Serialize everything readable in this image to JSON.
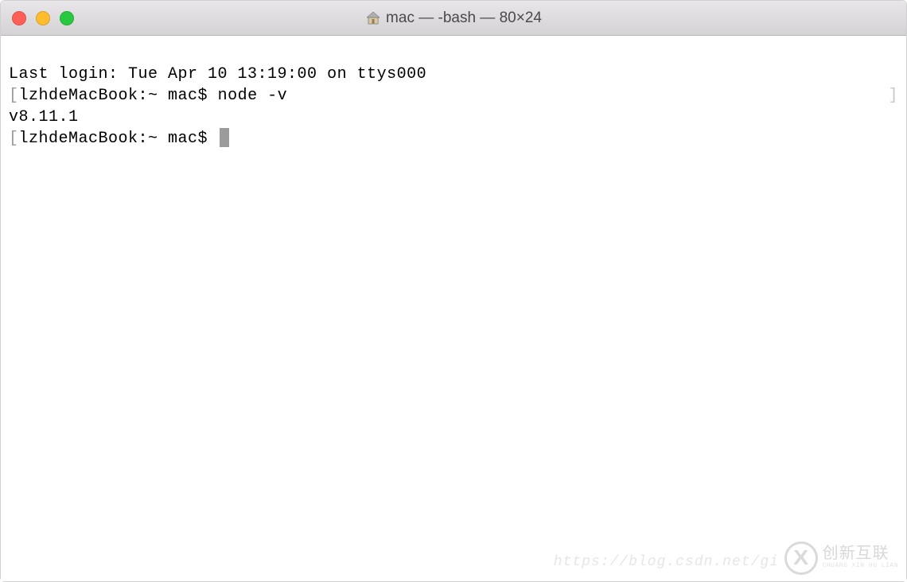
{
  "window": {
    "title": "mac — -bash — 80×24"
  },
  "terminal": {
    "lines": {
      "last_login": "Last login: Tue Apr 10 13:19:00 on ttys000",
      "prompt1_host": "lzhdeMacBook:~ mac$ ",
      "prompt1_cmd": "node -v",
      "output1": "v8.11.1",
      "prompt2_host": "lzhdeMacBook:~ mac$ "
    }
  },
  "watermark": {
    "url": "https://blog.csdn.net/gi",
    "logo_main": "创新互联",
    "logo_sub": "CHUANG XIN HU LIAN"
  }
}
